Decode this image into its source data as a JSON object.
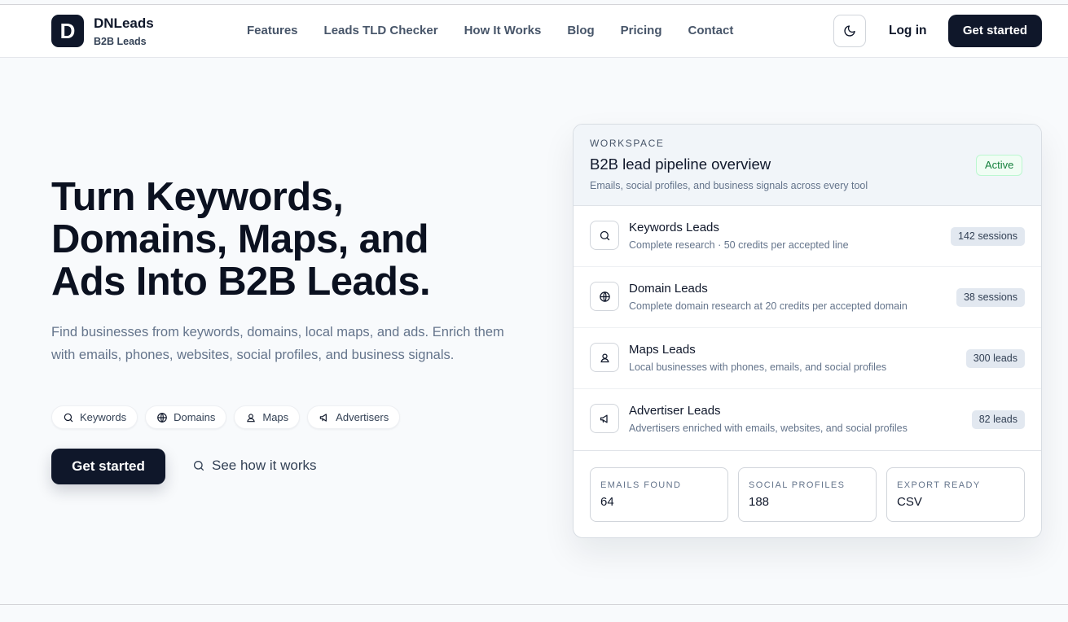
{
  "brand": {
    "logo_letter": "D",
    "name": "DNLeads",
    "tagline": "B2B Leads"
  },
  "nav": {
    "items": [
      {
        "label": "Features"
      },
      {
        "label": "Leads TLD Checker"
      },
      {
        "label": "How It Works"
      },
      {
        "label": "Blog"
      },
      {
        "label": "Pricing"
      },
      {
        "label": "Contact"
      }
    ],
    "theme_icon": "moon-icon",
    "login_label": "Log in",
    "cta_label": "Get started"
  },
  "hero": {
    "title_line1": "Turn Keywords,",
    "title_line2": "Domains, Maps, and",
    "title_line3": "Ads Into B2B Leads.",
    "description": "Find businesses from keywords, domains, local maps, and ads. Enrich them with emails, phones, websites, social profiles, and business signals.",
    "pills": [
      {
        "label": "Keywords",
        "icon": "search-icon"
      },
      {
        "label": "Domains",
        "icon": "globe-icon"
      },
      {
        "label": "Maps",
        "icon": "user-pin-icon"
      },
      {
        "label": "Advertisers",
        "icon": "megaphone-icon"
      }
    ],
    "primary_cta": "Get started",
    "secondary_cta": "See how it works"
  },
  "workspace": {
    "eyebrow": "WORKSPACE",
    "title": "B2B lead pipeline overview",
    "subtitle": "Emails, social profiles, and business signals across every tool",
    "status": "Active",
    "status_color": "#15803d",
    "rows": [
      {
        "icon": "search-icon",
        "title": "Keywords Leads",
        "subtitle": "Complete research · 50 credits per accepted line",
        "badge": "142 sessions"
      },
      {
        "icon": "globe-icon",
        "title": "Domain Leads",
        "subtitle": "Complete domain research at 20 credits per accepted domain",
        "badge": "38 sessions"
      },
      {
        "icon": "user-pin-icon",
        "title": "Maps Leads",
        "subtitle": "Local businesses with phones, emails, and social profiles",
        "badge": "300 leads"
      },
      {
        "icon": "megaphone-icon",
        "title": "Advertiser Leads",
        "subtitle": "Advertisers enriched with emails, websites, and social profiles",
        "badge": "82 leads"
      }
    ],
    "stats": [
      {
        "label": "EMAILS FOUND",
        "value": "64"
      },
      {
        "label": "SOCIAL PROFILES",
        "value": "188"
      },
      {
        "label": "EXPORT READY",
        "value": "CSV"
      }
    ]
  },
  "colors": {
    "primary": "#0f172a",
    "background": "#f8fafc",
    "muted_text": "#64748b"
  }
}
